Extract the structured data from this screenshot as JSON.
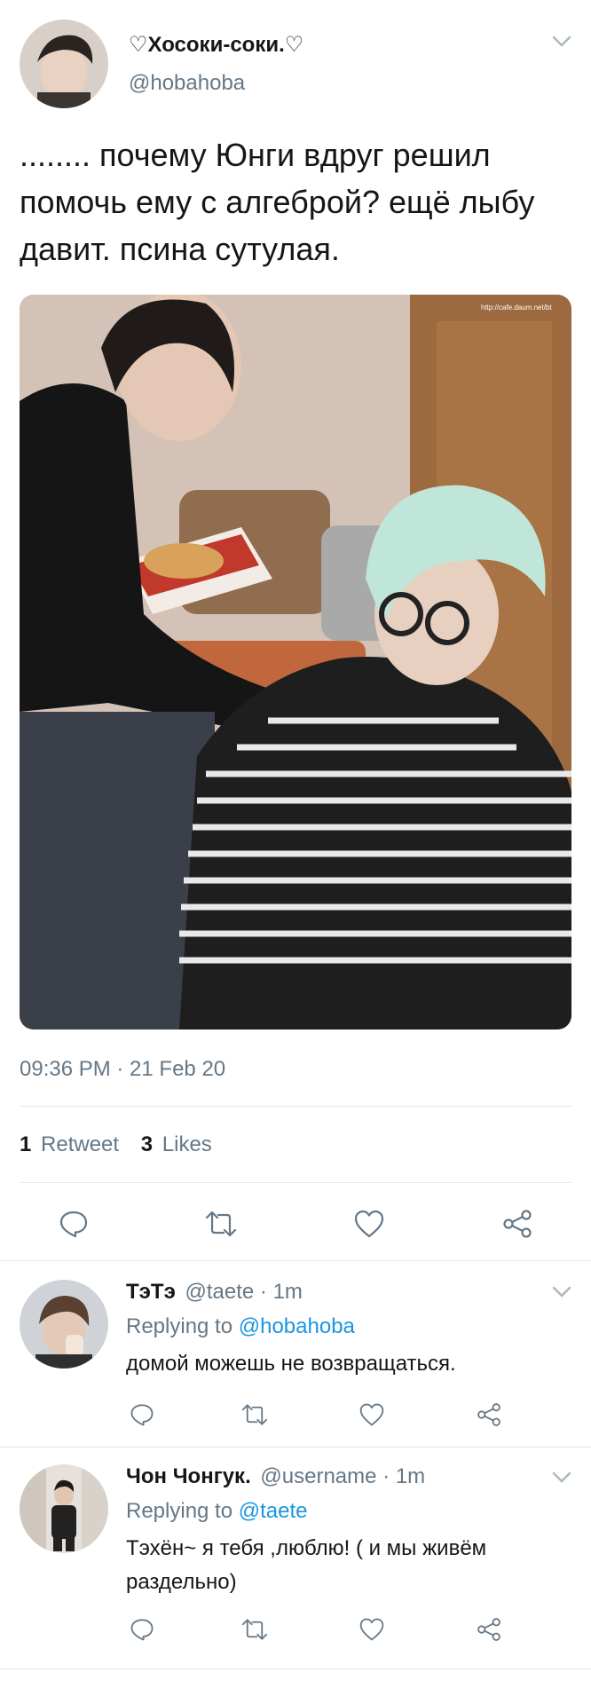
{
  "tweet": {
    "display_name": "♡Хосоки-соки.♡",
    "handle": "@hobahoba",
    "text": "........ почему Юнги вдруг решил помочь ему с алгеброй? ещё лыбу давит. псина сутулая.",
    "photo_watermark": "http://cafe.daum.net/bt",
    "timestamp": "09:36 PM · 21 Feb 20",
    "retweet_count": "1",
    "retweet_label": "Retweet",
    "like_count": "3",
    "like_label": "Likes"
  },
  "replies": [
    {
      "display_name": "ТэТэ",
      "handle_time": "@taete · 1m",
      "replying_prefix": "Replying to",
      "replying_handle": "@hobahoba",
      "text": "домой можешь не возвращаться."
    },
    {
      "display_name": "Чон Чонгук.",
      "handle_time": "@username · 1m",
      "replying_prefix": "Replying to",
      "replying_handle": "@taete",
      "text": "Тэхён~ я тебя ,люблю! ( и мы живём раздельно)"
    }
  ],
  "icons": [
    "chevron-down-icon",
    "reply-icon",
    "retweet-icon",
    "like-icon",
    "share-icon"
  ],
  "colors": {
    "link": "#1b95e0",
    "muted": "#657786",
    "divider": "#e1e8ed"
  }
}
